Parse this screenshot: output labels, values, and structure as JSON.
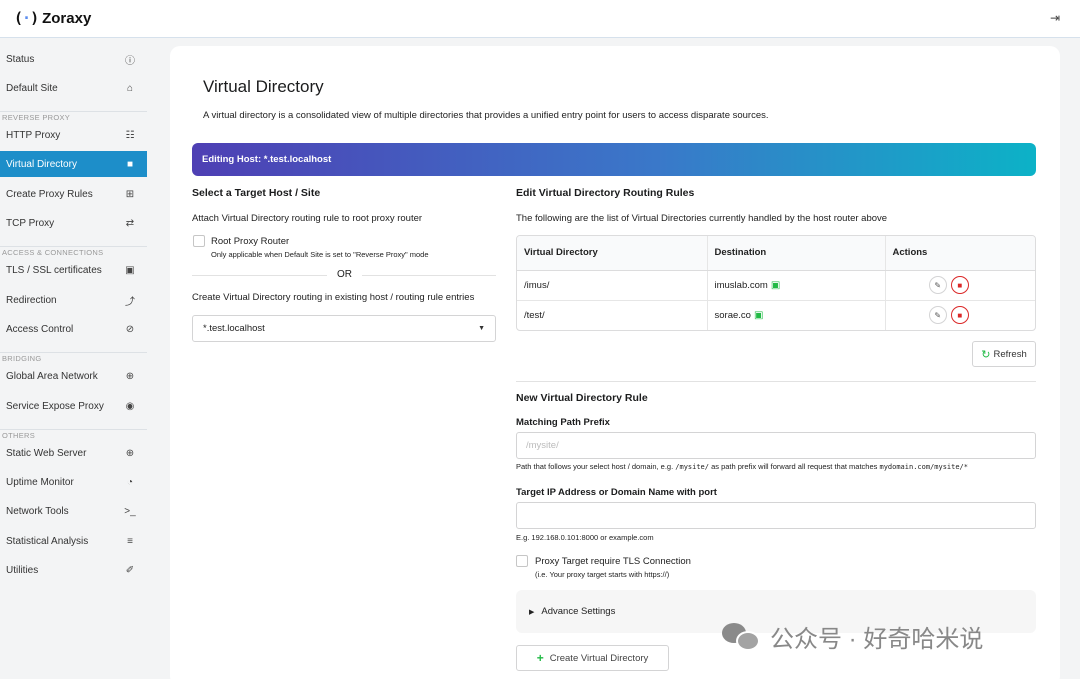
{
  "app": {
    "name": "Zoraxy",
    "logo_glyph": "(·)"
  },
  "header": {
    "logout_icon": "sign-out-icon"
  },
  "sidebar": {
    "items": [
      {
        "label": "Status",
        "icon": "info-circle-icon"
      },
      {
        "label": "Default Site",
        "icon": "home-icon"
      },
      {
        "section": "REVERSE PROXY"
      },
      {
        "label": "HTTP Proxy",
        "icon": "sitemap-icon"
      },
      {
        "label": "Virtual Directory",
        "icon": "folder-icon",
        "active": true
      },
      {
        "label": "Create Proxy Rules",
        "icon": "plus-square-icon"
      },
      {
        "label": "TCP Proxy",
        "icon": "exchange-icon"
      },
      {
        "section": "ACCESS & CONNECTIONS"
      },
      {
        "label": "TLS / SSL certificates",
        "icon": "lock-icon"
      },
      {
        "label": "Redirection",
        "icon": "level-up-icon"
      },
      {
        "label": "Access Control",
        "icon": "ban-icon"
      },
      {
        "section": "BRIDGING"
      },
      {
        "label": "Global Area Network",
        "icon": "globe-icon"
      },
      {
        "label": "Service Expose Proxy",
        "icon": "podcast-icon"
      },
      {
        "section": "OTHERS"
      },
      {
        "label": "Static Web Server",
        "icon": "globe-icon"
      },
      {
        "label": "Uptime Monitor",
        "icon": "clock-icon"
      },
      {
        "label": "Network Tools",
        "icon": "terminal-icon"
      },
      {
        "label": "Statistical Analysis",
        "icon": "database-icon"
      },
      {
        "label": "Utilities",
        "icon": "paperclip-icon"
      }
    ]
  },
  "page": {
    "title": "Virtual Directory",
    "description": "A virtual directory is a consolidated view of multiple directories that provides a unified entry point for users to access disparate sources.",
    "banner": "Editing Host: *.test.localhost"
  },
  "left_panel": {
    "title": "Select a Target Host / Site",
    "attach_text": "Attach Virtual Directory routing rule to root proxy router",
    "root_router_label": "Root Proxy Router",
    "root_router_hint": "Only applicable when Default Site is set to \"Reverse Proxy\" mode",
    "or_text": "OR",
    "existing_text": "Create Virtual Directory routing in existing host / routing rule entries",
    "selected_host": "*.test.localhost"
  },
  "right_panel": {
    "title": "Edit Virtual Directory Routing Rules",
    "subtitle": "The following are the list of Virtual Directories currently handled by the host router above",
    "table": {
      "headers": [
        "Virtual Directory",
        "Destination",
        "Actions"
      ],
      "rows": [
        {
          "vdir": "/imus/",
          "destination": "imuslab.com"
        },
        {
          "vdir": "/test/",
          "destination": "sorae.co"
        }
      ]
    },
    "refresh_label": "Refresh"
  },
  "new_rule": {
    "title": "New Virtual Directory Rule",
    "path_label": "Matching Path Prefix",
    "path_placeholder": "/mysite/",
    "path_hint_a": "Path that follows your select host / domain, e.g. ",
    "path_hint_code1": "/mysite/",
    "path_hint_b": " as path prefix will forward all request that matches ",
    "path_hint_code2": "mydomain.com/mysite/*",
    "target_label": "Target IP Address or Domain Name with port",
    "target_hint": "E.g. 192.168.0.101:8000 or example.com",
    "tls_label": "Proxy Target require TLS Connection",
    "tls_hint": "(i.e. Your proxy target starts with https://)",
    "advance_label": "Advance Settings",
    "create_label": "Create Virtual Directory"
  },
  "watermark": {
    "text": "公众号 · 好奇哈米说"
  }
}
